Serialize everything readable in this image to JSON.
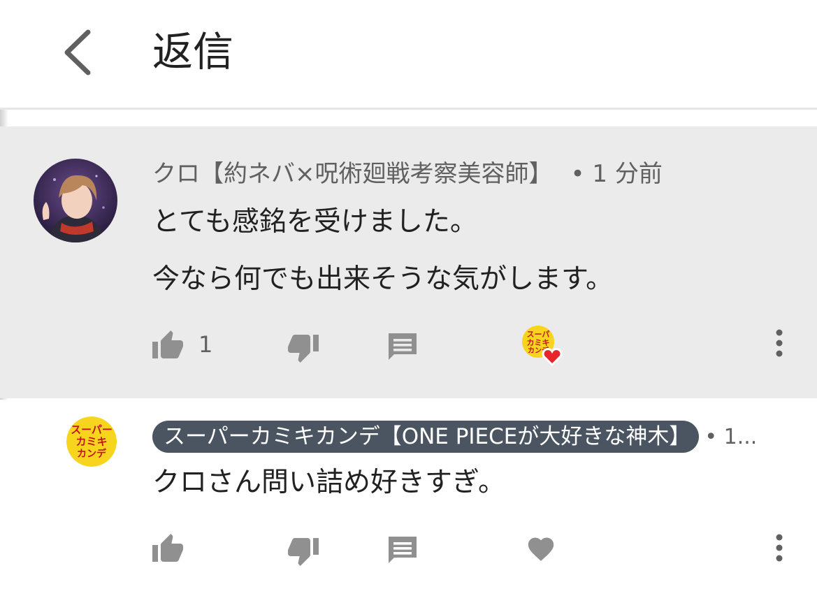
{
  "header": {
    "title": "返信"
  },
  "comments": [
    {
      "author": "クロ【約ネバ×呪術廻戦考察美容師】",
      "time": "1 分前",
      "text_lines": [
        "とても感銘を受けました。",
        "今なら何でも出来そうな気がします。"
      ],
      "like_count": "1",
      "creator_heart": true
    },
    {
      "author": "スーパーカミキカンデ【ONE PIECEが大好きな神木】",
      "time": "1...",
      "text_lines": [
        "クロさん問い詰め好きすぎ。"
      ],
      "creator_heart": false
    }
  ],
  "icons": [
    "chevron-left-icon",
    "thumb-up-icon",
    "thumb-down-icon",
    "reply-icon",
    "creator-heart-icon",
    "heart-icon",
    "more-vert-icon"
  ],
  "colors": {
    "highlight_bg": "#ebebeb",
    "author_pill_bg": "#4b5562",
    "icon_gray": "#909090",
    "heart_red": "#e6262b",
    "brand_yellow": "#f7d51e"
  }
}
